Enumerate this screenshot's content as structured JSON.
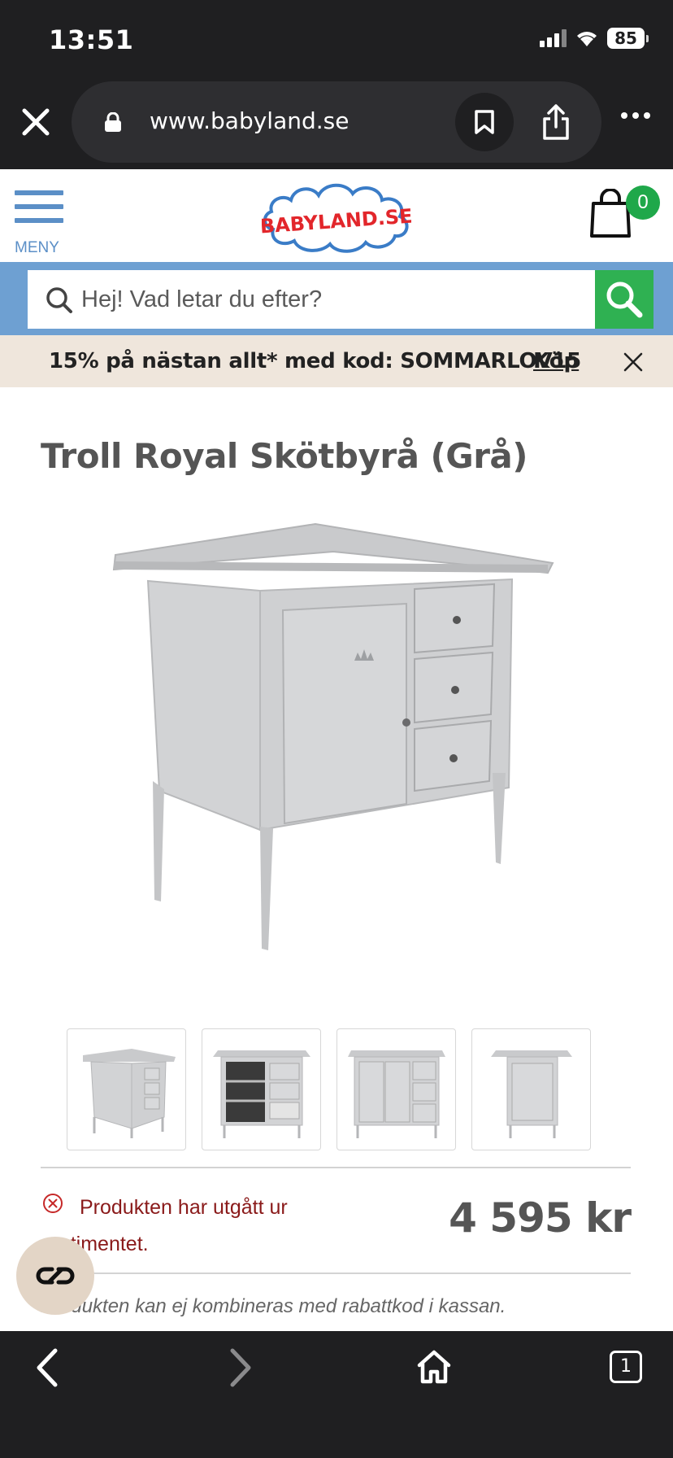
{
  "status_bar": {
    "time": "13:51",
    "battery": "85"
  },
  "browser": {
    "url": "www.babyland.se",
    "tab_count": "1"
  },
  "header": {
    "menu_label": "MENY",
    "logo_text": "BABYLAND.SE",
    "cart_count": "0"
  },
  "search": {
    "placeholder": "Hej! Vad letar du efter?"
  },
  "promo": {
    "text": "15% på nästan allt* med kod: SOMMARLOV15",
    "link": "Köp"
  },
  "product": {
    "title": "Troll Royal Skötbyrå (Grå)",
    "stock_status": "Produkten har utgått ur sortimentet.",
    "price": "4 595 kr",
    "note": "Produkten kan ej kombineras med rabattkod i kassan.",
    "thumbnails": [
      "thumb-1",
      "thumb-2",
      "thumb-3",
      "thumb-4"
    ]
  },
  "colors": {
    "brand_blue": "#6ea0d2",
    "search_green": "#2fb152",
    "promo_bg": "#efe6dc",
    "error_red": "#8a1a1a",
    "dark_chrome": "#1f1f21"
  },
  "icons": [
    "close-icon",
    "lock-icon",
    "bookmark-icon",
    "share-icon",
    "more-icon",
    "menu-icon",
    "cart-icon",
    "search-icon",
    "error-circle-icon",
    "chat-icon",
    "back-icon",
    "forward-icon",
    "home-icon",
    "tabs-icon"
  ]
}
